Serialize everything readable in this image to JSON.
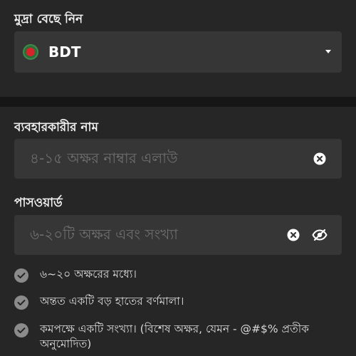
{
  "currency": {
    "label": "মুদ্রা বেছে নিন",
    "selected": "BDT",
    "flag_icon": "bangladesh-flag-icon"
  },
  "username": {
    "label": "ব্যবহারকারীর নাম",
    "placeholder": "৪-১৫ অক্ষর নাম্বার এলাউ"
  },
  "password": {
    "label": "পাসওয়ার্ড",
    "placeholder": "৬-২০টি অক্ষর এবং সংখ্যা"
  },
  "rules": [
    "৬~২০ অক্ষরের মধ্যে।",
    "অন্তত একটি বড় হাতের বর্ণমালা।",
    "কমপক্ষে একটি সংখ্যা। (বিশেষ অক্ষর, যেমন - @#$% প্রতীক অনুমোদিত)"
  ],
  "colors": {
    "background": "#1e1e1e",
    "card": "#262626",
    "field": "#363636",
    "check": "#8b8b8b"
  }
}
